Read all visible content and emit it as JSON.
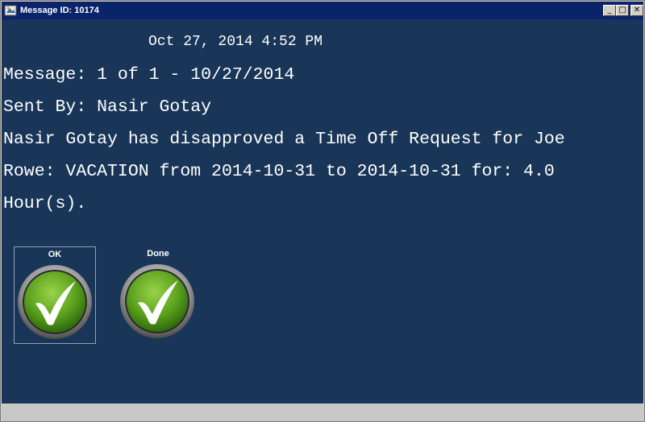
{
  "window": {
    "title": "Message ID: 10174",
    "minimize_glyph": "_",
    "maximize_glyph": "□",
    "close_glyph": "✕"
  },
  "message": {
    "timestamp": "Oct 27, 2014 4:52 PM",
    "counter_line": "Message: 1 of 1 - 10/27/2014",
    "sender_line": "Sent By: Nasir Gotay",
    "body_lines": [
      "Nasir Gotay has disapproved a Time Off Request for Joe",
      "Rowe: VACATION from 2014-10-31 to 2014-10-31 for: 4.0",
      "Hour(s)."
    ]
  },
  "actions": {
    "ok_label": "OK",
    "done_label": "Done"
  },
  "colors": {
    "background": "#193557",
    "titlebar": "#0a246a",
    "button_green": "#5ca21e",
    "checkmark": "#ffffff"
  },
  "icons": {
    "ok": "checkmark-icon",
    "done": "checkmark-icon"
  }
}
